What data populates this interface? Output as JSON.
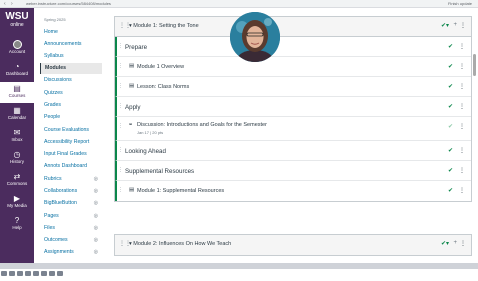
{
  "browser": {
    "url": "weber.instructure.com/courses/584408/modules",
    "profile": "Finish update"
  },
  "globalnav": {
    "logo_main": "WSU",
    "logo_sub": "online",
    "items": [
      {
        "label": "Account",
        "icon": "account-icon"
      },
      {
        "label": "Dashboard",
        "icon": "dashboard-icon"
      },
      {
        "label": "Courses",
        "icon": "courses-icon"
      },
      {
        "label": "Calendar",
        "icon": "calendar-icon"
      },
      {
        "label": "Inbox",
        "icon": "inbox-icon"
      },
      {
        "label": "History",
        "icon": "history-icon"
      },
      {
        "label": "Commons",
        "icon": "commons-icon"
      },
      {
        "label": "My Media",
        "icon": "my-media-icon"
      },
      {
        "label": "Help",
        "icon": "help-icon"
      }
    ]
  },
  "coursenav": {
    "term": "Spring 2025",
    "items": [
      "Home",
      "Announcements",
      "Syllabus",
      "Modules",
      "Discussions",
      "Quizzes",
      "Grades",
      "People",
      "Course Evaluations",
      "Accessibility Report",
      "Input Final Grades",
      "Annots Dashboard",
      "Rubrics",
      "Collaborations",
      "BigBlueButton",
      "Pages",
      "Files",
      "Outcomes",
      "Assignments"
    ],
    "active": "Modules"
  },
  "module1": {
    "title": "Module 1: Setting the Tone",
    "rows": [
      {
        "type": "header",
        "title": "Prepare"
      },
      {
        "type": "item",
        "title": "Module 1 Overview",
        "icon": "page-icon"
      },
      {
        "type": "item",
        "title": "Lesson: Class Norms",
        "icon": "page-icon"
      },
      {
        "type": "header",
        "title": "Apply"
      },
      {
        "type": "item",
        "title": "Discussion: Introductions and Goals for the Semester",
        "icon": "discussion-icon",
        "meta": "Jan 17  |  20 pts"
      },
      {
        "type": "header",
        "title": "Looking Ahead"
      },
      {
        "type": "header",
        "title": "Supplemental Resources"
      },
      {
        "type": "item",
        "title": "Module 1: Supplemental Resources",
        "icon": "page-icon"
      }
    ]
  },
  "module2": {
    "title": "Module 2: Influences On How We Teach"
  },
  "colors": {
    "brand": "#4b2c5e",
    "published": "#0b874b",
    "link": "#0770a3"
  }
}
